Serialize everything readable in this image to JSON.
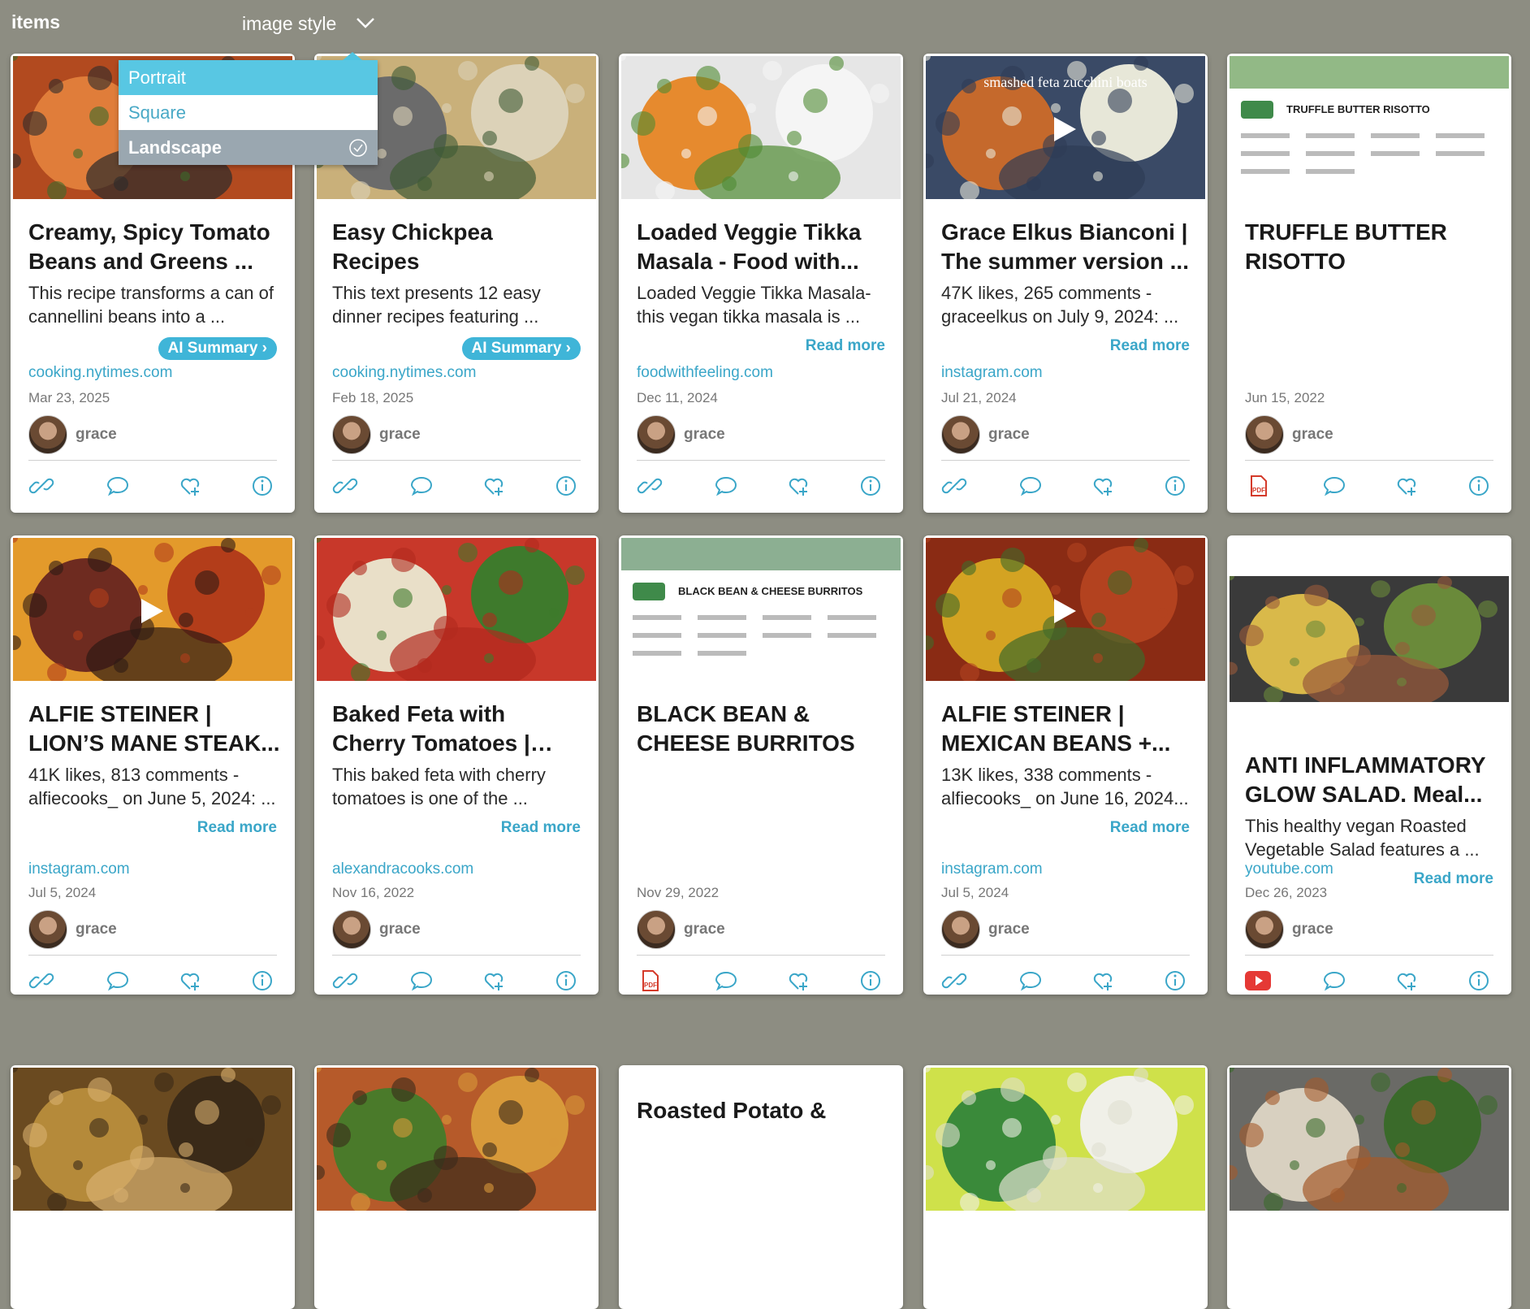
{
  "header": {
    "title": "items",
    "image_style_label": "image style"
  },
  "image_style_menu": {
    "options": [
      "Portrait",
      "Square",
      "Landscape"
    ],
    "selected": "Landscape"
  },
  "cards": [
    {
      "title": "Creamy, Spicy Tomato Beans and Greens ...",
      "desc": "This recipe transforms a can of cannellini beans into a ...",
      "button": "AI Summary",
      "domain": "cooking.nytimes.com",
      "date": "Mar 23, 2025",
      "user": "grace",
      "source_icon": "link-icon"
    },
    {
      "title": "Easy Chickpea Recipes",
      "desc": "This text presents 12 easy dinner recipes featuring ...",
      "button": "AI Summary",
      "domain": "cooking.nytimes.com",
      "date": "Feb 18, 2025",
      "user": "grace",
      "source_icon": "link-icon"
    },
    {
      "title": "Loaded Veggie Tikka Masala - Food with...",
      "desc": "Loaded Veggie Tikka Masala- this vegan tikka masala is ...",
      "button": "Read more",
      "domain": "foodwithfeeling.com",
      "date": "Dec 11, 2024",
      "user": "grace",
      "source_icon": "link-icon"
    },
    {
      "title": "Grace Elkus Bianconi | The summer version ...",
      "desc": "47K likes, 265 comments - graceelkus on July 9, 2024: ...",
      "button": "Read more",
      "domain": "instagram.com",
      "date": "Jul 21, 2024",
      "user": "grace",
      "source_icon": "link-icon",
      "image_text": "smashed feta zucchini boats"
    },
    {
      "title": "TRUFFLE BUTTER RISOTTO",
      "desc": "",
      "button": "",
      "domain": "",
      "date": "Jun 15, 2022",
      "user": "grace",
      "source_icon": "pdf-icon",
      "image_text": "TRUFFLE BUTTER RISOTTO"
    },
    {
      "title": "ALFIE STEINER | LION’S MANE STEAK...",
      "desc": "41K likes, 813 comments - alfiecooks_ on June 5, 2024: ...",
      "button": "Read more",
      "domain": "instagram.com",
      "date": "Jul 5, 2024",
      "user": "grace",
      "source_icon": "link-icon"
    },
    {
      "title": "Baked Feta with Cherry Tomatoes | Alexandra...",
      "desc": "This baked feta with cherry tomatoes is one of the ...",
      "button": "Read more",
      "domain": "alexandracooks.com",
      "date": "Nov 16, 2022",
      "user": "grace",
      "source_icon": "link-icon"
    },
    {
      "title": "BLACK BEAN & CHEESE BURRITOS",
      "desc": "",
      "button": "",
      "domain": "",
      "date": "Nov 29, 2022",
      "user": "grace",
      "source_icon": "pdf-icon",
      "image_text": "BLACK BEAN & CHEESE BURRITOS"
    },
    {
      "title": "ALFIE STEINER | MEXICAN BEANS +...",
      "desc": "13K likes, 338 comments - alfiecooks_ on June 16, 2024...",
      "button": "Read more",
      "domain": "instagram.com",
      "date": "Jul 5, 2024",
      "user": "grace",
      "source_icon": "link-icon"
    },
    {
      "title": "ANTI INFLAMMATORY GLOW SALAD. Meal...",
      "desc": "This healthy vegan Roasted Vegetable Salad features a ...",
      "button": "Read more",
      "domain": "youtube.com",
      "date": "Dec 26, 2023",
      "user": "grace",
      "source_icon": "youtube-icon"
    },
    {
      "title": "",
      "desc": "",
      "button": "",
      "domain": "",
      "date": "",
      "user": "",
      "source_icon": ""
    },
    {
      "title": "",
      "desc": "",
      "button": "",
      "domain": "",
      "date": "",
      "user": "",
      "source_icon": ""
    },
    {
      "title": "Roasted Potato &",
      "desc": "",
      "button": "",
      "domain": "",
      "date": "",
      "user": "",
      "source_icon": ""
    },
    {
      "title": "",
      "desc": "",
      "button": "",
      "domain": "",
      "date": "",
      "user": "",
      "source_icon": ""
    },
    {
      "title": "",
      "desc": "",
      "button": "",
      "domain": "",
      "date": "",
      "user": "",
      "source_icon": ""
    }
  ]
}
